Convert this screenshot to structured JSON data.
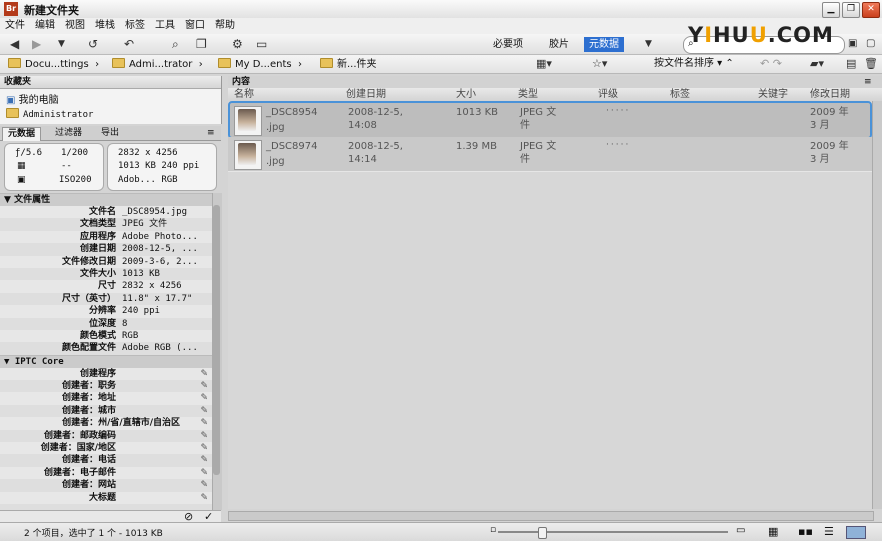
{
  "window": {
    "app_icon_text": "Br",
    "title": "新建文件夹",
    "minimize": "▁",
    "maximize": "❐",
    "close": "✕"
  },
  "menu": [
    "文件",
    "编辑",
    "视图",
    "堆栈",
    "标签",
    "工具",
    "窗口",
    "帮助"
  ],
  "toolbar": {
    "workspaces": [
      "必要项",
      "胶片",
      "元数据"
    ],
    "active_workspace": "元数据",
    "search_placeholder": ""
  },
  "watermark": {
    "part1": "Y",
    "highlight1": "I",
    "part2": "HU",
    "highlight2": "U",
    "part3": ".COM"
  },
  "breadcrumb": [
    "Docu...ttings",
    "Admi...trator",
    "My D...ents",
    "新...件夹"
  ],
  "pathbar": {
    "sort_label": "按文件名排序"
  },
  "favorites": {
    "title": "收藏夹",
    "items": [
      "我的电脑",
      "Administrator"
    ]
  },
  "left_tabs": [
    "元数据",
    "过滤器",
    "导出"
  ],
  "camera_info": {
    "aperture": "ƒ/5.6",
    "shutter": "1/200",
    "metering": "--",
    "iso": "ISO200",
    "dimensions": "2832 x 4256",
    "size_res": "1013 KB   240 ppi",
    "color": "Adob...  RGB"
  },
  "file_properties": {
    "title": "文件属性",
    "rows": [
      {
        "label": "文件名",
        "value": "_DSC8954.jpg"
      },
      {
        "label": "文档类型",
        "value": "JPEG 文件"
      },
      {
        "label": "应用程序",
        "value": "Adobe Photo..."
      },
      {
        "label": "创建日期",
        "value": "2008-12-5, ..."
      },
      {
        "label": "文件修改日期",
        "value": "2009-3-6, 2..."
      },
      {
        "label": "文件大小",
        "value": "1013 KB"
      },
      {
        "label": "尺寸",
        "value": "2832 x 4256"
      },
      {
        "label": "尺寸（英寸）",
        "value": "11.8\" x 17.7\""
      },
      {
        "label": "分辨率",
        "value": "240 ppi"
      },
      {
        "label": "位深度",
        "value": "8"
      },
      {
        "label": "颜色模式",
        "value": "RGB"
      },
      {
        "label": "颜色配置文件",
        "value": "Adobe RGB (..."
      }
    ]
  },
  "iptc": {
    "title": "IPTC Core",
    "rows": [
      "创建程序",
      "创建者：职务",
      "创建者：地址",
      "创建者：城市",
      "创建者：州/省/直辖市/自治区",
      "创建者：邮政编码",
      "创建者：国家/地区",
      "创建者：电话",
      "创建者：电子邮件",
      "创建者：网站",
      "大标题"
    ]
  },
  "content": {
    "tab": "内容",
    "columns": [
      "名称",
      "创建日期",
      "大小",
      "类型",
      "评级",
      "标签",
      "关键字",
      "修改日期"
    ],
    "files": [
      {
        "name1": "_DSC8954",
        "name2": ".jpg",
        "date1": "2008-12-5,",
        "date2": "14:08",
        "size": "1013 KB",
        "type1": "JPEG 文",
        "type2": "件",
        "rating": "·····",
        "mod1": "2009 年",
        "mod2": "3 月"
      },
      {
        "name1": "_DSC8974",
        "name2": ".jpg",
        "date1": "2008-12-5,",
        "date2": "14:14",
        "size": "1.39 MB",
        "type1": "JPEG 文",
        "type2": "件",
        "rating": "·····",
        "mod1": "2009 年",
        "mod2": "3 月"
      }
    ]
  },
  "status": {
    "text": "2 个项目，选中了 1 个 - 1013 KB"
  }
}
